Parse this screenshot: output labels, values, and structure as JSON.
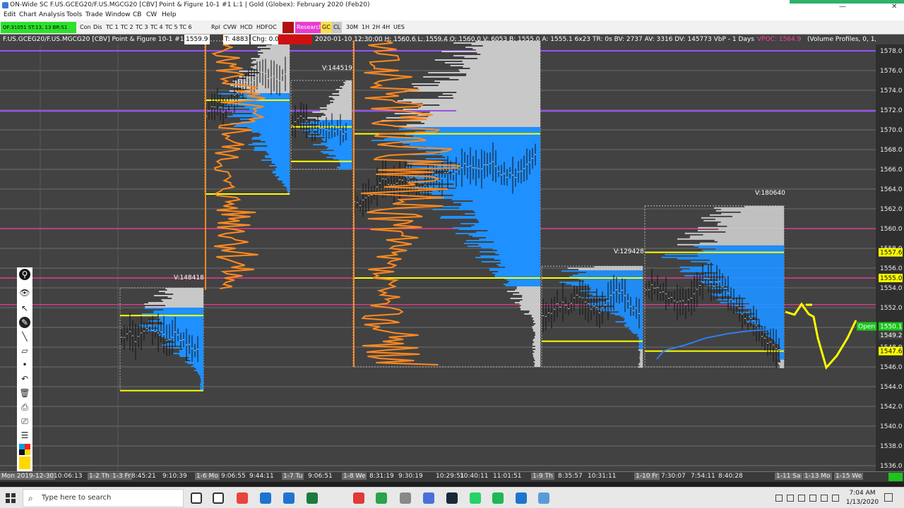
{
  "window": {
    "title": "ON-Wide  SC F.US.GCEG20/F.US.MGCG20 [CBV]  Point & Figure 10-1  #1  L:1 | Gold (Globex): February 2020 (Feb20)",
    "minimize": "—",
    "close": "✕"
  },
  "menu": [
    "Edit",
    "Chart",
    "Analysis",
    "Tools",
    "Trade",
    "Window",
    "CB",
    "CW",
    "Help"
  ],
  "toolbar": {
    "status": "OF:31051  ST:13, 13  BR:S1",
    "buttons": [
      "Con",
      "Dis",
      "TC 1",
      "TC 2",
      "TC 3",
      "TC 4",
      "TC 5",
      "TC 6",
      "Rpl",
      "CVW",
      "HCD",
      "HDFOC",
      "Research",
      "GC",
      "CL",
      "30M",
      "1H",
      "2H",
      "4H",
      "UES"
    ]
  },
  "infobar": {
    "symbol": "F.US.GCEG20/F.US.MGCG20 [CBV]  Point & Figure 10-1  #1",
    "price": "1559.9",
    "t_value": "T: 4883",
    "chg": "Chg: 0.0",
    "bar_info": "2020-01-10 12:30:00 H: 1560.6 L: 1559.4 O: 1560.0 V: 6053 B: 1555.0 A: 1555.1 6x23 TR: 0s BV: 2737 AV: 3316 DV: 145773 VbP - 1 Days",
    "vpoc": "VPOC: 1564.9",
    "study": "(Volume Profiles, 0, 1,"
  },
  "chart_data": {
    "type": "other",
    "ylim": [
      1535.2,
      1579.1
    ],
    "y_ticks": [
      "1578.0",
      "1576.0",
      "1574.0",
      "1572.0",
      "1570.0",
      "1568.0",
      "1566.0",
      "1564.0",
      "1562.0",
      "1560.0",
      "1558.0",
      "1556.0",
      "1554.0",
      "1552.0",
      "1550.0",
      "1548.0",
      "1546.0",
      "1544.0",
      "1542.0",
      "1540.0",
      "1538.0",
      "1536.0"
    ],
    "price_labels": [
      {
        "text": "1557.6",
        "color": "#ffff00"
      },
      {
        "text": "1555.0",
        "color": "#ffff00"
      },
      {
        "text": "Open",
        "color": "#1cc41c"
      },
      {
        "text": "1550.1",
        "color": "#1cc41c"
      },
      {
        "text": "1549.2",
        "color": "#404040"
      },
      {
        "text": "1547.6",
        "color": "#ffff00"
      }
    ],
    "volume_labels": [
      "V:144519",
      "V:148418",
      "V:180640",
      "V:129428"
    ],
    "hlines": [
      {
        "price": 1578.0,
        "color": "#9d4fff"
      },
      {
        "price": 1571.9,
        "color": "#9d4fff"
      },
      {
        "price": 1560.0,
        "color": "#ff3fa0"
      },
      {
        "price": 1555.0,
        "color": "#ff3fa0"
      },
      {
        "price": 1552.3,
        "color": "#ff3fa0"
      }
    ],
    "profiles": [
      {
        "left": 170,
        "right": 288,
        "top": 1554.0,
        "bottom": 1543.6,
        "poc": 1551.2,
        "val": 1543.6,
        "vah": 1551.2,
        "color": "#1e90ff"
      },
      {
        "left": 290,
        "right": 410,
        "top": 1579.0,
        "bottom": 1563.5,
        "poc": 1573.0,
        "val": 1563.5,
        "vah": 1573.0,
        "color": "#1e90ff"
      },
      {
        "left": 412,
        "right": 498,
        "top": 1575.0,
        "bottom": 1566.0,
        "poc": 1570.3,
        "val": 1566.8,
        "vah": 1570.3,
        "color": "#1e90ff"
      },
      {
        "left": 500,
        "right": 765,
        "top": 1579.0,
        "bottom": 1546.0,
        "poc": 1569.6,
        "val": 1555.0,
        "vah": 1569.6,
        "color": "#1e90ff"
      },
      {
        "left": 767,
        "right": 910,
        "top": 1556.2,
        "bottom": 1546.0,
        "poc": 1555.0,
        "val": 1548.6,
        "vah": 1555.0,
        "color": "#1e90ff"
      },
      {
        "left": 913,
        "right": 1110,
        "top": 1562.3,
        "bottom": 1546.0,
        "poc": 1557.6,
        "val": 1547.6,
        "vah": 1557.6,
        "color": "#1e90ff"
      }
    ],
    "time_ticks": [
      "Mon 2019-12-30",
      "10:06:13",
      "1-2 Th",
      "1-3 Fr",
      "8:45:21",
      "9:10:39",
      "1-6 Mo",
      "9:06:55",
      "9:44:11",
      "1-7 Tu",
      "9:06:51",
      "1-8 We",
      "8:31:19",
      "9:30:19",
      "10:29:51",
      "10:40:11",
      "11:01:51",
      "1-9 Th",
      "8:35:57",
      "10:31:11",
      "1-10 Fr",
      "7:30:07",
      "7:54:11",
      "8:40:28",
      "1-11 Sa",
      "1-13 Mo",
      "1-15 We"
    ]
  },
  "taskbar": {
    "search_placeholder": "Type here to search",
    "time": "7:04 AM",
    "date": "1/13/2020"
  }
}
